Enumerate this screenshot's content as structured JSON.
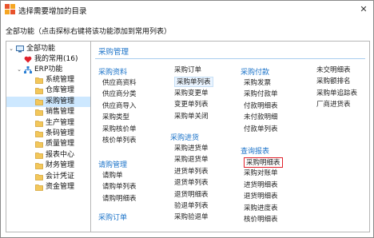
{
  "window": {
    "title": "选择需要增加的目录",
    "close_glyph": "✕"
  },
  "hint": "全部功能（点击探标右键将该功能添加到常用列表）",
  "tree": {
    "root": "全部功能",
    "favorites": "我的常用(16)",
    "erp": "ERP功能",
    "modules": [
      "系统管理",
      "仓库管理",
      "采购管理",
      "销售管理",
      "生产管理",
      "条码管理",
      "质量管理",
      "报表中心",
      "财务管理",
      "会计凭证",
      "资金管理"
    ],
    "selected_index": 2
  },
  "content": {
    "heading": "采购管理",
    "col1": {
      "group1": "采购资料",
      "items1": [
        "供应商资料",
        "供应商分类",
        "供应商导入",
        "采购类型",
        "采购核价单",
        "核价单列表"
      ],
      "group2": "请购管理",
      "items2": [
        "请购单",
        "请购单列表",
        "请购明细表"
      ],
      "group3": "采购订单"
    },
    "col2": {
      "items1": [
        "采购订单",
        "采购单列表",
        "采购变更单",
        "变更单列表",
        "采购单关闭"
      ],
      "group": "采购进货",
      "items2": [
        "采购进货单",
        "采购退货单",
        "进货单列表",
        "退货单列表",
        "退货明细表",
        "验退单列表",
        "采购验退单"
      ]
    },
    "col3": {
      "group1": "采购付款",
      "items1": [
        "采购发票",
        "采购付款单",
        "付款明细表",
        "未付款明细",
        "付款单列表"
      ],
      "group2": "查询报表",
      "items2": [
        "采购明细表",
        "采购对账单",
        "进货明细表",
        "退货明细表",
        "采购进度表",
        "核价明细表"
      ]
    },
    "col4": {
      "items": [
        "未交明细表",
        "采购额排名",
        "采购单追踪表",
        "厂商进货表"
      ]
    }
  }
}
